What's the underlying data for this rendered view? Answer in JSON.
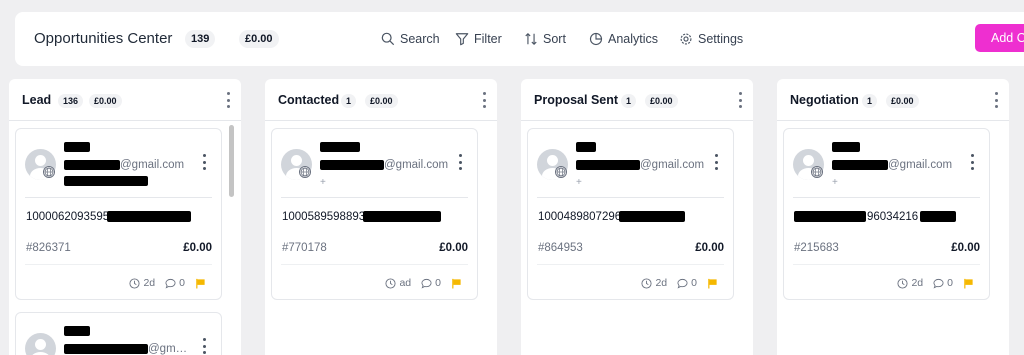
{
  "header": {
    "title": "Opportunities Center",
    "count": "139",
    "amount": "£0.00",
    "toolbar": {
      "search": "Search",
      "filter": "Filter",
      "sort": "Sort",
      "analytics": "Analytics",
      "settings": "Settings"
    },
    "add_button": "Add O"
  },
  "columns": [
    {
      "title": "Lead",
      "count": "136",
      "amount": "£0.00",
      "cards": [
        {
          "email": "@gmail.com",
          "opp_name": "1000062093595",
          "id": "#826371",
          "value": "£0.00",
          "age": "2d",
          "comments": "0",
          "phone": ""
        },
        {
          "email": "@gm…"
        }
      ]
    },
    {
      "title": "Contacted",
      "count": "1",
      "amount": "£0.00",
      "cards": [
        {
          "email": "@gmail.com",
          "phone": "+",
          "opp_name": "1000589598893",
          "id": "#770178",
          "value": "£0.00",
          "age": "ad",
          "comments": "0"
        }
      ]
    },
    {
      "title": "Proposal Sent",
      "count": "1",
      "amount": "£0.00",
      "cards": [
        {
          "email": "@gmail.com",
          "phone": "+",
          "opp_name": "1000489807296",
          "id": "#864953",
          "value": "£0.00",
          "age": "2d",
          "comments": "0"
        }
      ]
    },
    {
      "title": "Negotiation",
      "count": "1",
      "amount": "£0.00",
      "cards": [
        {
          "email": "@gmail.com",
          "phone": "+",
          "opp_name": "96034216",
          "id": "#215683",
          "value": "£0.00",
          "age": "2d",
          "comments": "0"
        }
      ]
    }
  ],
  "colors": {
    "accent": "#ee2fd0",
    "flag": "#f5b800",
    "background": "#efeff1"
  }
}
